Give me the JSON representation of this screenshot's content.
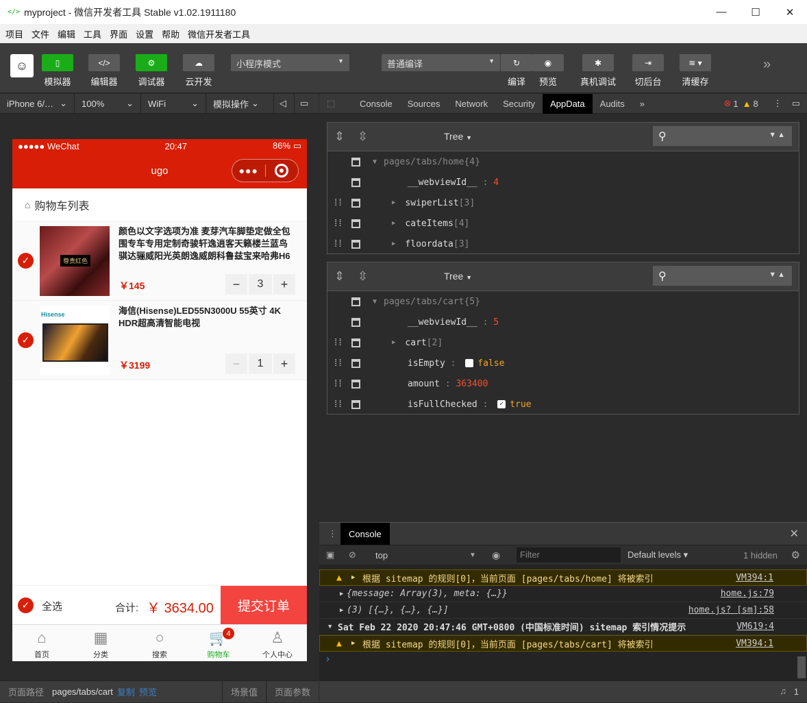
{
  "window": {
    "title": "myproject - 微信开发者工具 Stable v1.02.1911180",
    "min": "—",
    "max": "☐",
    "close": "✕"
  },
  "menu": [
    "项目",
    "文件",
    "编辑",
    "工具",
    "界面",
    "设置",
    "帮助",
    "微信开发者工具"
  ],
  "toolbar": {
    "simulator": "模拟器",
    "editor": "编辑器",
    "debugger": "调试器",
    "cloud": "云开发",
    "mode": "小程序模式",
    "compile": "普通编译",
    "compile_btn": "编译",
    "preview": "预览",
    "realdebug": "真机调试",
    "background": "切后台",
    "clearcache": "清缓存"
  },
  "devbar": {
    "device": "iPhone 6/…",
    "zoom": "100%",
    "network": "WiFi",
    "sim_ops": "模拟操作"
  },
  "phone": {
    "status": {
      "carrier": "●●●●● WeChat",
      "time": "20:47",
      "battery": "86%"
    },
    "nav_title": "ugo",
    "cart_title": "购物车列表",
    "items": [
      {
        "name": "颜色以文字选项为准 麦芽汽车脚垫定做全包围专车专用定制奇骏轩逸逍客天籁楼兰蓝鸟骐达骊威阳光英朗逸威朗科鲁兹宝来哈弗H6",
        "price": "￥145",
        "qty": "3",
        "img_label": "尊贵红色"
      },
      {
        "name": "海信(Hisense)LED55N3000U 55英寸 4K HDR超高清智能电视",
        "price": "￥3199",
        "qty": "1",
        "img_label": "Hisense"
      }
    ],
    "select_all": "全选",
    "total_label": "合计:",
    "total_value": "￥ 3634.00",
    "submit": "提交订单",
    "tabs": [
      "首页",
      "分类",
      "搜索",
      "购物车",
      "个人中心"
    ],
    "cart_badge": "4"
  },
  "pagebar": {
    "path_label": "页面路径",
    "path": "pages/tabs/cart",
    "copy": "复制",
    "preview": "预览",
    "scene": "场景值",
    "params": "页面参数"
  },
  "devtabs": [
    "Console",
    "Sources",
    "Network",
    "Security",
    "AppData",
    "Audits"
  ],
  "devcounts": {
    "errors": "1",
    "warnings": "8"
  },
  "tree_label": "Tree",
  "tree_home": {
    "root": "pages/tabs/home",
    "root_count": "{4}",
    "rows": [
      {
        "key": "__webviewId__",
        "val": "4"
      },
      {
        "key": "swiperList",
        "count": "[3]"
      },
      {
        "key": "cateItems",
        "count": "[4]"
      },
      {
        "key": "floordata",
        "count": "[3]"
      }
    ]
  },
  "tree_cart": {
    "root": "pages/tabs/cart",
    "root_count": "{5}",
    "rows": [
      {
        "key": "__webviewId__",
        "val": "5"
      },
      {
        "key": "cart",
        "count": "[2]"
      },
      {
        "key": "isEmpty",
        "val": "false"
      },
      {
        "key": "amount",
        "val": "363400"
      },
      {
        "key": "isFullChecked",
        "val": "true"
      }
    ]
  },
  "console": {
    "tab": "Console",
    "context": "top",
    "filter_placeholder": "Filter",
    "levels": "Default levels",
    "hidden": "1 hidden",
    "rows": [
      {
        "msg": "根据 sitemap 的规则[0]，当前页面 [pages/tabs/home] 将被索引",
        "src": "VM394:1"
      },
      {
        "msg": "{message: Array(3), meta: {…}}",
        "src": "home.js:79"
      },
      {
        "msg": "(3) [{…}, {…}, {…}]",
        "src": "home.js? [sm]:58"
      },
      {
        "msg": "Sat Feb 22 2020 20:47:46 GMT+0800 (中国标准时间) sitemap 索引情况提示",
        "src": "VM619:4"
      },
      {
        "msg": "根据 sitemap 的规则[0]，当前页面 [pages/tabs/cart] 将被索引",
        "src": "VM394:1"
      }
    ],
    "prompt": "›",
    "bell_count": "1"
  },
  "colors": {
    "brand_red": "#d81e06",
    "wechat_green": "#1aad19",
    "submit_red": "#f3443f"
  }
}
